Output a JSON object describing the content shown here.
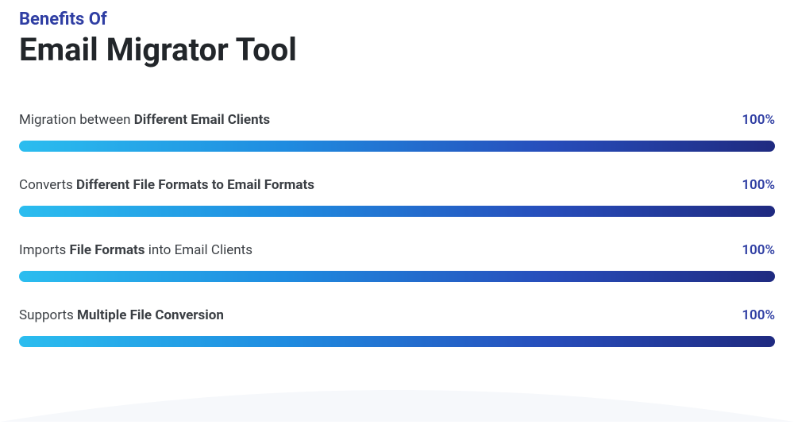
{
  "header": {
    "eyebrow": "Benefits Of",
    "title": "Email Migrator Tool"
  },
  "chart_data": {
    "type": "bar",
    "title": "Benefits Of Email Migrator Tool",
    "xlabel": "",
    "ylabel": "",
    "ylim": [
      0,
      100
    ],
    "categories": [
      "Migration between Different Email Clients",
      "Converts Different File Formats to Email Formats",
      "Imports File Formats into Email Clients",
      "Supports Multiple File Conversion"
    ],
    "values": [
      100,
      100,
      100,
      100
    ]
  },
  "benefits": [
    {
      "prefix": "Migration between ",
      "bold": "Different Email Clients",
      "suffix": "",
      "pct": "100%"
    },
    {
      "prefix": "Converts ",
      "bold": "Different File Formats to Email Formats",
      "suffix": "",
      "pct": "100%"
    },
    {
      "prefix": "Imports ",
      "bold": "File Formats",
      "suffix": " into Email Clients",
      "pct": "100%"
    },
    {
      "prefix": "Supports ",
      "bold": "Multiple File Conversion",
      "suffix": "",
      "pct": "100%"
    }
  ]
}
